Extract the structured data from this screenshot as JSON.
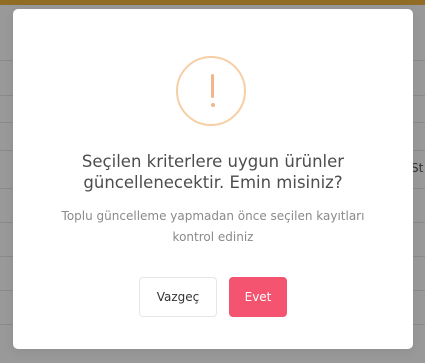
{
  "background": {
    "side_text": "St"
  },
  "dialog": {
    "icon": "exclamation-warning-icon",
    "title": "Seçilen kriterlere uygun ürünler güncellenecektir. Emin misiniz?",
    "message": "Toplu güncelleme yapmadan önce seçilen kayıtları kontrol ediniz",
    "cancel_label": "Vazgeç",
    "confirm_label": "Evet"
  },
  "colors": {
    "accent_bar": "#f0b43c",
    "warning": "#f2b68c",
    "confirm": "#f45470"
  }
}
